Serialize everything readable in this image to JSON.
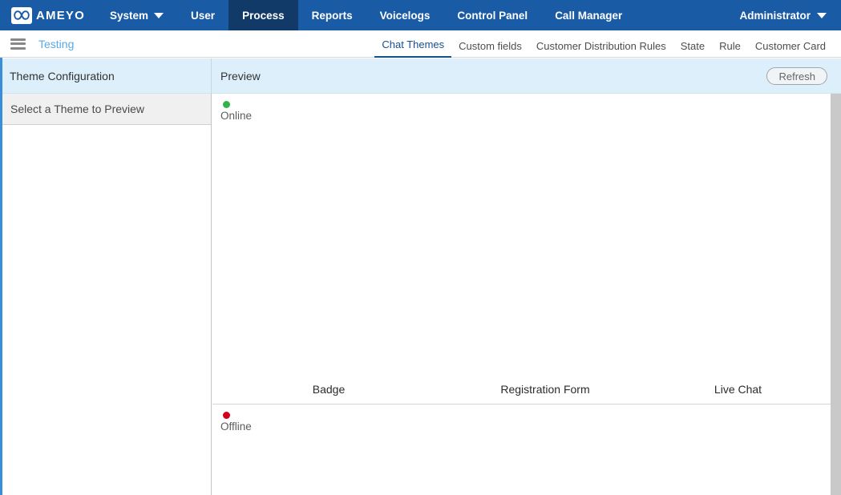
{
  "topnav": {
    "logo_text": "AMEYO",
    "logo_icon": "infinity-icon",
    "items": [
      {
        "label": "System",
        "active": false,
        "has_caret": true
      },
      {
        "label": "User",
        "active": false,
        "has_caret": false
      },
      {
        "label": "Process",
        "active": true,
        "has_caret": false
      },
      {
        "label": "Reports",
        "active": false,
        "has_caret": false
      },
      {
        "label": "Voicelogs",
        "active": false,
        "has_caret": false
      },
      {
        "label": "Control Panel",
        "active": false,
        "has_caret": false
      },
      {
        "label": "Call Manager",
        "active": false,
        "has_caret": false
      }
    ],
    "user_label": "Administrator",
    "user_caret_icon": "chevron-down-icon"
  },
  "subnav": {
    "menu_icon": "hamburger-icon",
    "breadcrumb": "Testing",
    "tabs": [
      {
        "label": "Chat Themes",
        "active": true
      },
      {
        "label": "Custom fields",
        "active": false
      },
      {
        "label": "Customer Distribution Rules",
        "active": false
      },
      {
        "label": "State",
        "active": false
      },
      {
        "label": "Rule",
        "active": false
      },
      {
        "label": "Customer Card",
        "active": false
      }
    ]
  },
  "panels": {
    "left_title": "Theme Configuration",
    "right_title": "Preview",
    "refresh_label": "Refresh",
    "theme_select_label": "Select a Theme to Preview"
  },
  "preview": {
    "online_label": "Online",
    "offline_label": "Offline",
    "section_labels": {
      "badge": "Badge",
      "registration_form": "Registration Form",
      "live_chat": "Live Chat"
    }
  },
  "colors": {
    "nav_blue": "#1a5ba6",
    "nav_active": "#123a68",
    "accent_blue": "#3a8dd8",
    "panel_header": "#ddeffa",
    "tab_active": "#15508f",
    "breadcrumb_blue": "#5aa9e6",
    "online_green": "#2fb34a",
    "offline_red": "#d0021b"
  }
}
